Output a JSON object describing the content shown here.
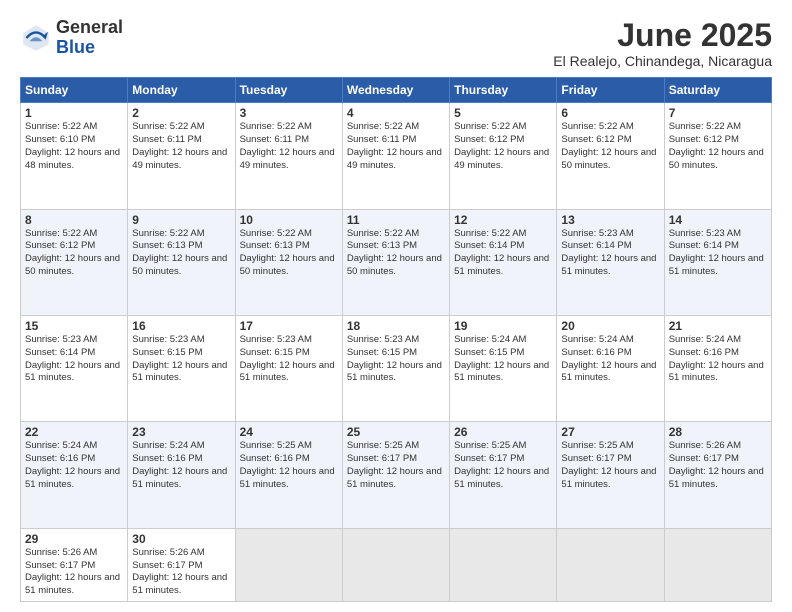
{
  "header": {
    "logo": {
      "general": "General",
      "blue": "Blue"
    },
    "title": "June 2025",
    "location": "El Realejo, Chinandega, Nicaragua"
  },
  "calendar": {
    "weekdays": [
      "Sunday",
      "Monday",
      "Tuesday",
      "Wednesday",
      "Thursday",
      "Friday",
      "Saturday"
    ],
    "weeks": [
      [
        {
          "day": "1",
          "sunrise": "5:22 AM",
          "sunset": "6:10 PM",
          "daylight": "12 hours and 48 minutes."
        },
        {
          "day": "2",
          "sunrise": "5:22 AM",
          "sunset": "6:11 PM",
          "daylight": "12 hours and 49 minutes."
        },
        {
          "day": "3",
          "sunrise": "5:22 AM",
          "sunset": "6:11 PM",
          "daylight": "12 hours and 49 minutes."
        },
        {
          "day": "4",
          "sunrise": "5:22 AM",
          "sunset": "6:11 PM",
          "daylight": "12 hours and 49 minutes."
        },
        {
          "day": "5",
          "sunrise": "5:22 AM",
          "sunset": "6:12 PM",
          "daylight": "12 hours and 49 minutes."
        },
        {
          "day": "6",
          "sunrise": "5:22 AM",
          "sunset": "6:12 PM",
          "daylight": "12 hours and 50 minutes."
        },
        {
          "day": "7",
          "sunrise": "5:22 AM",
          "sunset": "6:12 PM",
          "daylight": "12 hours and 50 minutes."
        }
      ],
      [
        {
          "day": "8",
          "sunrise": "5:22 AM",
          "sunset": "6:12 PM",
          "daylight": "12 hours and 50 minutes."
        },
        {
          "day": "9",
          "sunrise": "5:22 AM",
          "sunset": "6:13 PM",
          "daylight": "12 hours and 50 minutes."
        },
        {
          "day": "10",
          "sunrise": "5:22 AM",
          "sunset": "6:13 PM",
          "daylight": "12 hours and 50 minutes."
        },
        {
          "day": "11",
          "sunrise": "5:22 AM",
          "sunset": "6:13 PM",
          "daylight": "12 hours and 50 minutes."
        },
        {
          "day": "12",
          "sunrise": "5:22 AM",
          "sunset": "6:14 PM",
          "daylight": "12 hours and 51 minutes."
        },
        {
          "day": "13",
          "sunrise": "5:23 AM",
          "sunset": "6:14 PM",
          "daylight": "12 hours and 51 minutes."
        },
        {
          "day": "14",
          "sunrise": "5:23 AM",
          "sunset": "6:14 PM",
          "daylight": "12 hours and 51 minutes."
        }
      ],
      [
        {
          "day": "15",
          "sunrise": "5:23 AM",
          "sunset": "6:14 PM",
          "daylight": "12 hours and 51 minutes."
        },
        {
          "day": "16",
          "sunrise": "5:23 AM",
          "sunset": "6:15 PM",
          "daylight": "12 hours and 51 minutes."
        },
        {
          "day": "17",
          "sunrise": "5:23 AM",
          "sunset": "6:15 PM",
          "daylight": "12 hours and 51 minutes."
        },
        {
          "day": "18",
          "sunrise": "5:23 AM",
          "sunset": "6:15 PM",
          "daylight": "12 hours and 51 minutes."
        },
        {
          "day": "19",
          "sunrise": "5:24 AM",
          "sunset": "6:15 PM",
          "daylight": "12 hours and 51 minutes."
        },
        {
          "day": "20",
          "sunrise": "5:24 AM",
          "sunset": "6:16 PM",
          "daylight": "12 hours and 51 minutes."
        },
        {
          "day": "21",
          "sunrise": "5:24 AM",
          "sunset": "6:16 PM",
          "daylight": "12 hours and 51 minutes."
        }
      ],
      [
        {
          "day": "22",
          "sunrise": "5:24 AM",
          "sunset": "6:16 PM",
          "daylight": "12 hours and 51 minutes."
        },
        {
          "day": "23",
          "sunrise": "5:24 AM",
          "sunset": "6:16 PM",
          "daylight": "12 hours and 51 minutes."
        },
        {
          "day": "24",
          "sunrise": "5:25 AM",
          "sunset": "6:16 PM",
          "daylight": "12 hours and 51 minutes."
        },
        {
          "day": "25",
          "sunrise": "5:25 AM",
          "sunset": "6:17 PM",
          "daylight": "12 hours and 51 minutes."
        },
        {
          "day": "26",
          "sunrise": "5:25 AM",
          "sunset": "6:17 PM",
          "daylight": "12 hours and 51 minutes."
        },
        {
          "day": "27",
          "sunrise": "5:25 AM",
          "sunset": "6:17 PM",
          "daylight": "12 hours and 51 minutes."
        },
        {
          "day": "28",
          "sunrise": "5:26 AM",
          "sunset": "6:17 PM",
          "daylight": "12 hours and 51 minutes."
        }
      ],
      [
        {
          "day": "29",
          "sunrise": "5:26 AM",
          "sunset": "6:17 PM",
          "daylight": "12 hours and 51 minutes."
        },
        {
          "day": "30",
          "sunrise": "5:26 AM",
          "sunset": "6:17 PM",
          "daylight": "12 hours and 51 minutes."
        },
        null,
        null,
        null,
        null,
        null
      ]
    ]
  }
}
